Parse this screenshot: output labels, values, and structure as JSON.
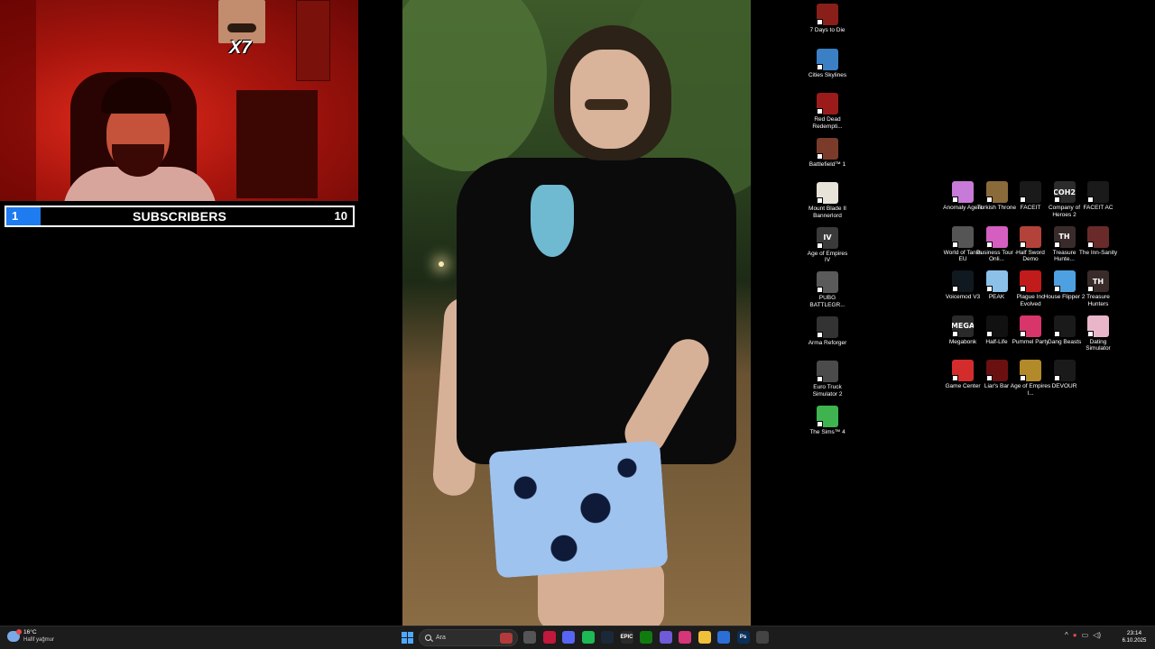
{
  "overlay": {
    "emote_count": "X7",
    "subscriber_goal": {
      "current": "1",
      "label": "SUBSCRIBERS",
      "goal": "10",
      "progress_fraction": 0.1,
      "fill_color": "#1e7bf0"
    }
  },
  "desktop": {
    "left_column": [
      {
        "label": "7 Days to Die",
        "icon": "7-days-to-die-icon",
        "color": "#8a1f1a"
      },
      {
        "label": "Cities Skylines",
        "icon": "cities-skylines-icon",
        "color": "#3b7fc4"
      },
      {
        "label": "Red Dead Redempti...",
        "icon": "red-dead-redemption-icon",
        "color": "#9b1b1b"
      },
      {
        "label": "Battlefield™ 1",
        "icon": "battlefield-1-icon",
        "color": "#7a3b2a"
      },
      {
        "label": "Mount Blade II Bannerlord",
        "icon": "mount-blade-icon",
        "color": "#e8e3d9"
      },
      {
        "label": "Age of Empires IV",
        "icon": "age-of-empires-iv-icon",
        "color": "#3a3a3a",
        "glyph": "IV"
      },
      {
        "label": "PUBG BATTLEGR...",
        "icon": "pubg-icon",
        "color": "#5a5a5a"
      },
      {
        "label": "Arma Reforger",
        "icon": "arma-reforger-icon",
        "color": "#333333"
      },
      {
        "label": "Euro Truck Simulator 2",
        "icon": "euro-truck-icon",
        "color": "#4b4b4b"
      },
      {
        "label": "The Sims™ 4",
        "icon": "sims-4-icon",
        "color": "#3fb34f"
      }
    ],
    "grid": [
      {
        "label": "Anomaly Agent",
        "icon": "anomaly-agent-icon",
        "color": "#c77ad8"
      },
      {
        "label": "Turkish Throne",
        "icon": "turkish-throne-icon",
        "color": "#8a6a3a"
      },
      {
        "label": "FACEIT",
        "icon": "faceit-icon",
        "color": "#1a1a1a"
      },
      {
        "label": "Company of Heroes 2",
        "icon": "company-of-heroes-2-icon",
        "color": "#2b2b2b",
        "glyph": "COH2"
      },
      {
        "label": "FACEIT AC",
        "icon": "faceit-ac-icon",
        "color": "#1a1a1a"
      },
      {
        "label": "World of Tanks EU",
        "icon": "world-of-tanks-icon",
        "color": "#555555"
      },
      {
        "label": "Business Tour - Onli...",
        "icon": "business-tour-icon",
        "color": "#d45fc1"
      },
      {
        "label": "Half Sword Demo",
        "icon": "half-sword-icon",
        "color": "#b3423a"
      },
      {
        "label": "Treasure Hunte...",
        "icon": "treasure-hunter-icon",
        "color": "#3a2b2b",
        "glyph": "TH"
      },
      {
        "label": "The Inn-Sanity",
        "icon": "inn-sanity-icon",
        "color": "#6b2a2a"
      },
      {
        "label": "Voicemod V3",
        "icon": "voicemod-icon",
        "color": "#101820"
      },
      {
        "label": "PEAK",
        "icon": "peak-icon",
        "color": "#8bc1e8"
      },
      {
        "label": "Plague Inc Evolved",
        "icon": "plague-inc-icon",
        "color": "#c21b1b"
      },
      {
        "label": "House Flipper 2",
        "icon": "house-flipper-icon",
        "color": "#4ea1e0"
      },
      {
        "label": "Treasure Hunters",
        "icon": "treasure-hunters-icon",
        "color": "#3a2b2b",
        "glyph": "TH"
      },
      {
        "label": "Megabonk",
        "icon": "megabonk-icon",
        "color": "#2a2a2a",
        "glyph": "MEGA"
      },
      {
        "label": "Half-Life",
        "icon": "half-life-icon",
        "color": "#111111"
      },
      {
        "label": "Pummel Party",
        "icon": "pummel-party-icon",
        "color": "#d8356a"
      },
      {
        "label": "Gang Beasts",
        "icon": "gang-beasts-icon",
        "color": "#1a1a1a"
      },
      {
        "label": "Dating Simulator",
        "icon": "dating-simulator-icon",
        "color": "#e9b6c9"
      },
      {
        "label": "Game Center",
        "icon": "game-center-icon",
        "color": "#d42c2c"
      },
      {
        "label": "Liar's Bar",
        "icon": "liars-bar-icon",
        "color": "#6b1010"
      },
      {
        "label": "Age of Empires I...",
        "icon": "age-of-empires-ii-icon",
        "color": "#b28a2a"
      },
      {
        "label": "DEVOUR",
        "icon": "devour-icon",
        "color": "#1a1a1a"
      }
    ]
  },
  "taskbar": {
    "weather_temp": "16°C",
    "weather_desc": "Hafif yağmur",
    "search_placeholder": "Ara",
    "apps": [
      {
        "name": "task-view-icon",
        "color": "#555555"
      },
      {
        "name": "opera-gx-icon",
        "color": "#c2183b"
      },
      {
        "name": "discord-icon",
        "color": "#5865f2"
      },
      {
        "name": "spotify-icon",
        "color": "#1db954"
      },
      {
        "name": "steam-icon",
        "color": "#1b2838"
      },
      {
        "name": "epic-games-icon",
        "color": "#2a2a2a",
        "glyph": "EPIC"
      },
      {
        "name": "xbox-icon",
        "color": "#107c10"
      },
      {
        "name": "copilot-icon",
        "color": "#6f5ad8"
      },
      {
        "name": "instagram-icon",
        "color": "#d6357a"
      },
      {
        "name": "file-explorer-icon",
        "color": "#f0c03a"
      },
      {
        "name": "mail-icon",
        "color": "#2b6fd6"
      },
      {
        "name": "photoshop-icon",
        "color": "#0c2f59",
        "glyph": "Ps"
      },
      {
        "name": "recorder-icon",
        "color": "#444444"
      }
    ],
    "time": "23:14",
    "date": "6.10.2025"
  }
}
